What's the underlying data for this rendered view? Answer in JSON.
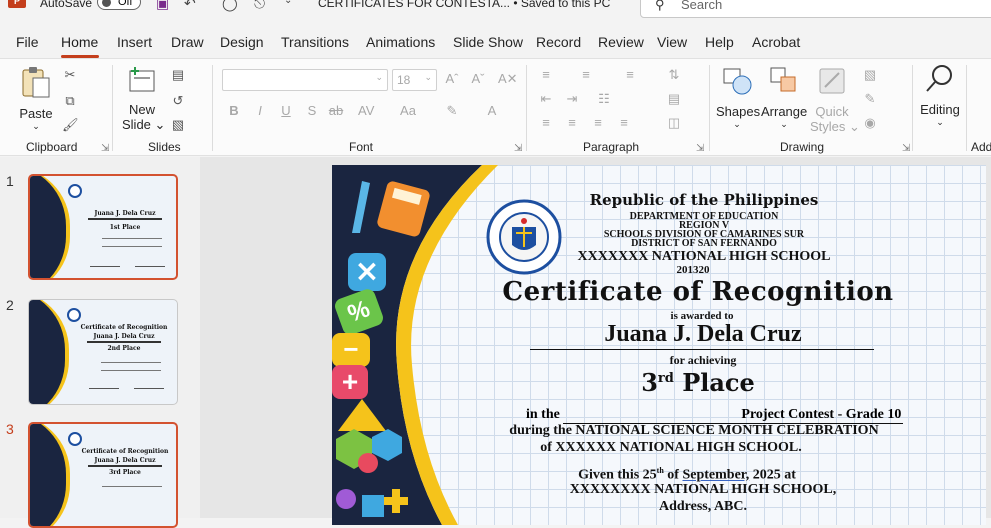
{
  "titlebar": {
    "autosave_label": "AutoSave",
    "autosave_state": "Off",
    "file_title": "CERTIFICATES FOR  CONTESTA...  •  Saved to this PC",
    "search_placeholder": "Search"
  },
  "tabs": [
    "File",
    "Home",
    "Insert",
    "Draw",
    "Design",
    "Transitions",
    "Animations",
    "Slide Show",
    "Record",
    "Review",
    "View",
    "Help",
    "Acrobat"
  ],
  "ribbon": {
    "paste": "Paste",
    "clipboard": "Clipboard",
    "new_slide_1": "New",
    "new_slide_2": "Slide",
    "slides": "Slides",
    "font_size": "18",
    "font": "Font",
    "paragraph": "Paragraph",
    "shapes": "Shapes",
    "arrange": "Arrange",
    "quick_styles_1": "Quick",
    "quick_styles_2": "Styles",
    "drawing": "Drawing",
    "editing": "Editing",
    "add_partial": "Add"
  },
  "thumbnails": [
    {
      "num": "1",
      "title": "Juana J. Dela Cruz",
      "place": "1st Place"
    },
    {
      "num": "2",
      "title": "Certificate of Recognition",
      "name": "Juana J. Dela Cruz",
      "place": "2nd Place"
    },
    {
      "num": "3",
      "title": "Certificate of Recognition",
      "name": "Juana J. Dela Cruz",
      "place": "3rd Place"
    }
  ],
  "certificate": {
    "republic": "Republic of the Philippines",
    "dept": "DEPARTMENT OF EDUCATION",
    "region": "REGION V",
    "division": "SCHOOLS DIVISION OF CAMARINES SUR",
    "district": "DISTRICT OF SAN FERNANDO",
    "school": "XXXXXXX NATIONAL HIGH SCHOOL",
    "school_id": "201320",
    "title": "Certificate of Recognition",
    "awarded": "is awarded to",
    "name": "Juana J. Dela Cruz",
    "achieving": "for achieving",
    "place_num": "3",
    "place_sup": "rd",
    "place_word": "Place",
    "in_the": "in the",
    "contest": "Project  Contest - Grade 10",
    "during": "during the NATIONAL SCIENCE MONTH CELEBRATION",
    "of_school": "of  XXXXXX NATIONAL HIGH SCHOOL.",
    "given_pre": "Given this 25",
    "given_sup": "th",
    "given_of": " of ",
    "given_month": "September,",
    "given_year": " 2025 at",
    "venue": "XXXXXXXX NATIONAL HIGH SCHOOL,",
    "address": "Address, ABC.",
    "seal_text": "KAGAWARAN NG EDUKASYON"
  },
  "colors": {
    "accent": "#c43e1c",
    "navy": "#1a2540",
    "gold": "#f5c31b"
  }
}
